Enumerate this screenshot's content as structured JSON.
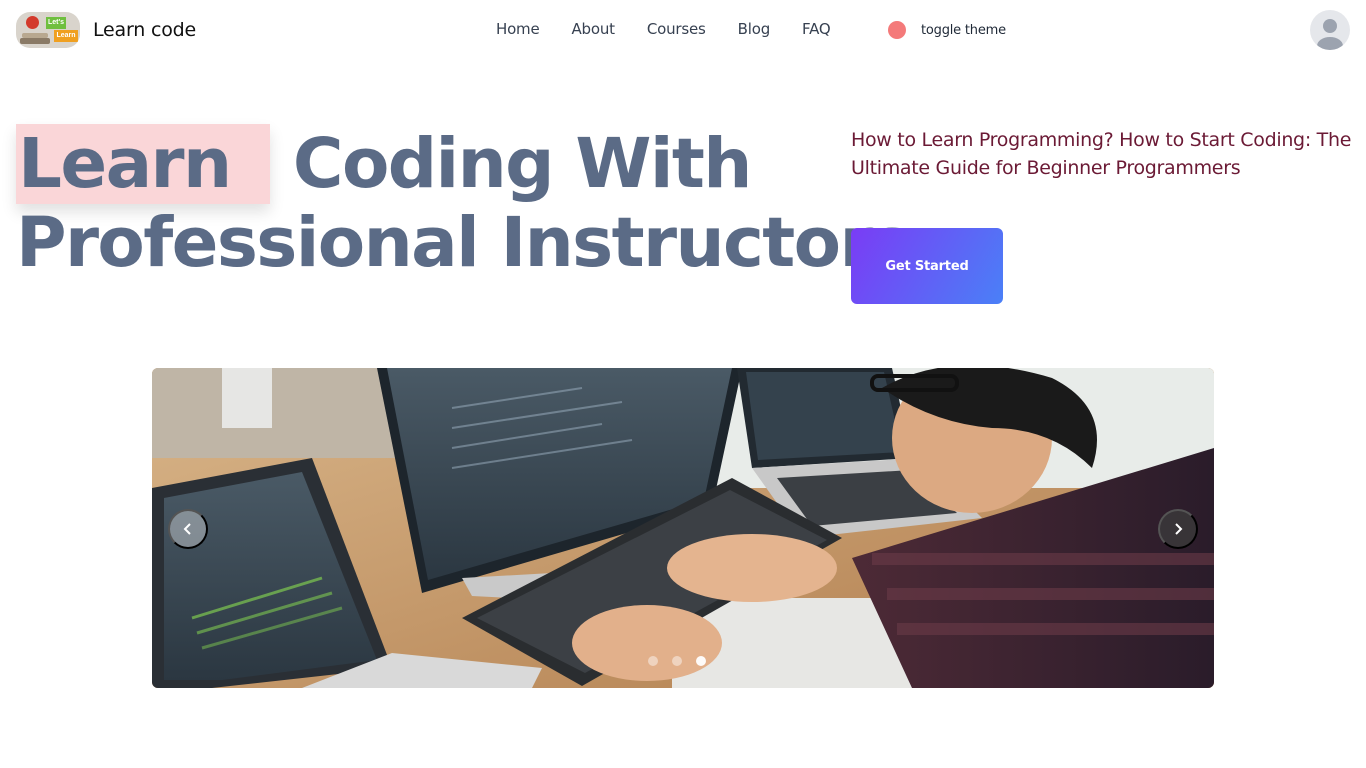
{
  "brand": {
    "name": "Learn code",
    "logo_tag_top": "Let's",
    "logo_tag_bottom": "Learn"
  },
  "nav": {
    "links": [
      "Home",
      "About",
      "Courses",
      "Blog",
      "FAQ"
    ]
  },
  "theme_toggle": {
    "label": "toggle theme",
    "dot_color": "#f47a7a"
  },
  "user": {
    "avatar_icon": "user-avatar-icon"
  },
  "hero": {
    "title_highlight": "Learn",
    "title_line1_rest": " Coding With",
    "title_line2": "Professional Instructors",
    "subtitle": "How to Learn Programming? How to Start Coding: The Ultimate Guide for Beginner Programmers",
    "cta_label": "Get Started",
    "title_color": "#5b6b86",
    "highlight_color": "#fad6d8",
    "subtitle_color": "#6b1a35",
    "cta_gradient": [
      "#7a3cf5",
      "#4a80f7"
    ]
  },
  "carousel": {
    "prev_icon": "chevron-left-icon",
    "next_icon": "chevron-right-icon",
    "slide_count": 3,
    "active_slide": 3
  }
}
